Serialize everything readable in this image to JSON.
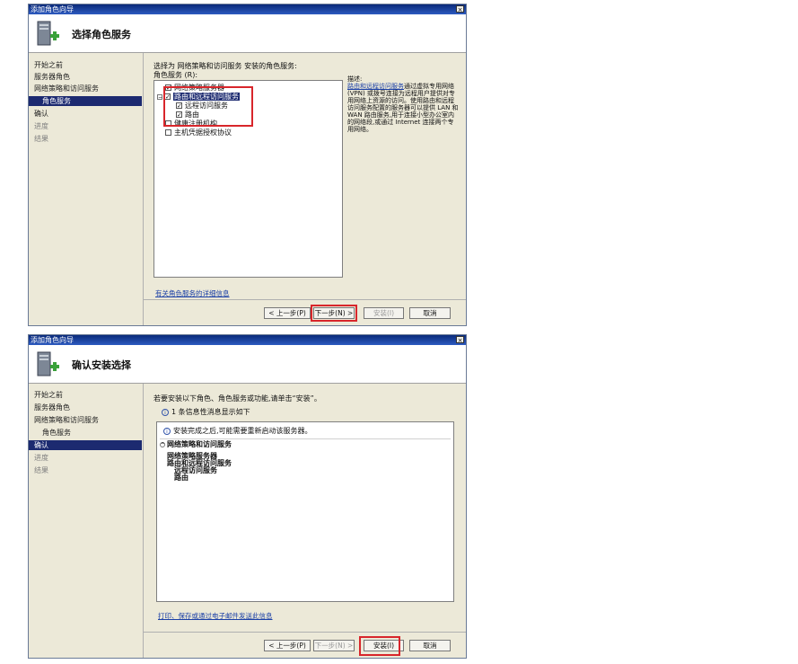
{
  "window1": {
    "title": "添加角色向导",
    "close": "×",
    "header_title": "选择角色服务",
    "nav": [
      "开始之前",
      "服务器角色",
      "网络策略和访问服务",
      "角色服务",
      "确认",
      "进度",
      "结果"
    ],
    "instruction": "选择为 网络策略和访问服务 安装的角色服务:",
    "list_label": "角色服务 (R):",
    "expander": "−",
    "tree": [
      {
        "label": "网络策略服务器",
        "checked": true
      },
      {
        "label": "路由和远程访问服务",
        "checked": true
      },
      {
        "label": "远程访问服务",
        "checked": true
      },
      {
        "label": "路由",
        "checked": true
      },
      {
        "label": "健康注册机构",
        "checked": false
      },
      {
        "label": "主机凭据授权协议",
        "checked": false
      }
    ],
    "desc_heading": "描述:",
    "desc_link": "路由和远程访问服务",
    "desc_text": "通过虚拟专用网络 (VPN) 或拨号连接为远程用户提供对专用网络上资源的访问。使用路由和远程访问服务配置的服务器可以提供 LAN 和 WAN 路由服务,用于连接小型办公室内的网络段,或通过 Internet 连接两个专用网络。",
    "more_link": "有关角色服务的详细信息",
    "buttons": {
      "prev": "< 上一步(P)",
      "next": "下一步(N) >",
      "install": "安装(I)",
      "cancel": "取消"
    }
  },
  "window2": {
    "title": "添加角色向导",
    "close": "×",
    "header_title": "确认安装选择",
    "nav": [
      "开始之前",
      "服务器角色",
      "网络策略和访问服务",
      "角色服务",
      "确认",
      "进度",
      "结果"
    ],
    "instruction": "若要安装以下角色、角色服务或功能,请单击“安装”。",
    "info_count": "1 条信息性消息显示如下",
    "info_restart": "安装完成之后,可能需要重新启动该服务器。",
    "section_title": "网络策略和访问服务",
    "section_toggle": "^",
    "items": [
      "网络策略服务器",
      "路由和远程访问服务",
      "远程访问服务",
      "路由"
    ],
    "print_link": "打印、保存或通过电子邮件发送此信息",
    "buttons": {
      "prev": "< 上一步(P)",
      "next": "下一步(N) >",
      "install": "安装(I)",
      "cancel": "取消"
    }
  },
  "colors": {
    "title_bar": "#1b3f9a",
    "highlight": "#1c2a70",
    "annotation": "#d8262b"
  }
}
